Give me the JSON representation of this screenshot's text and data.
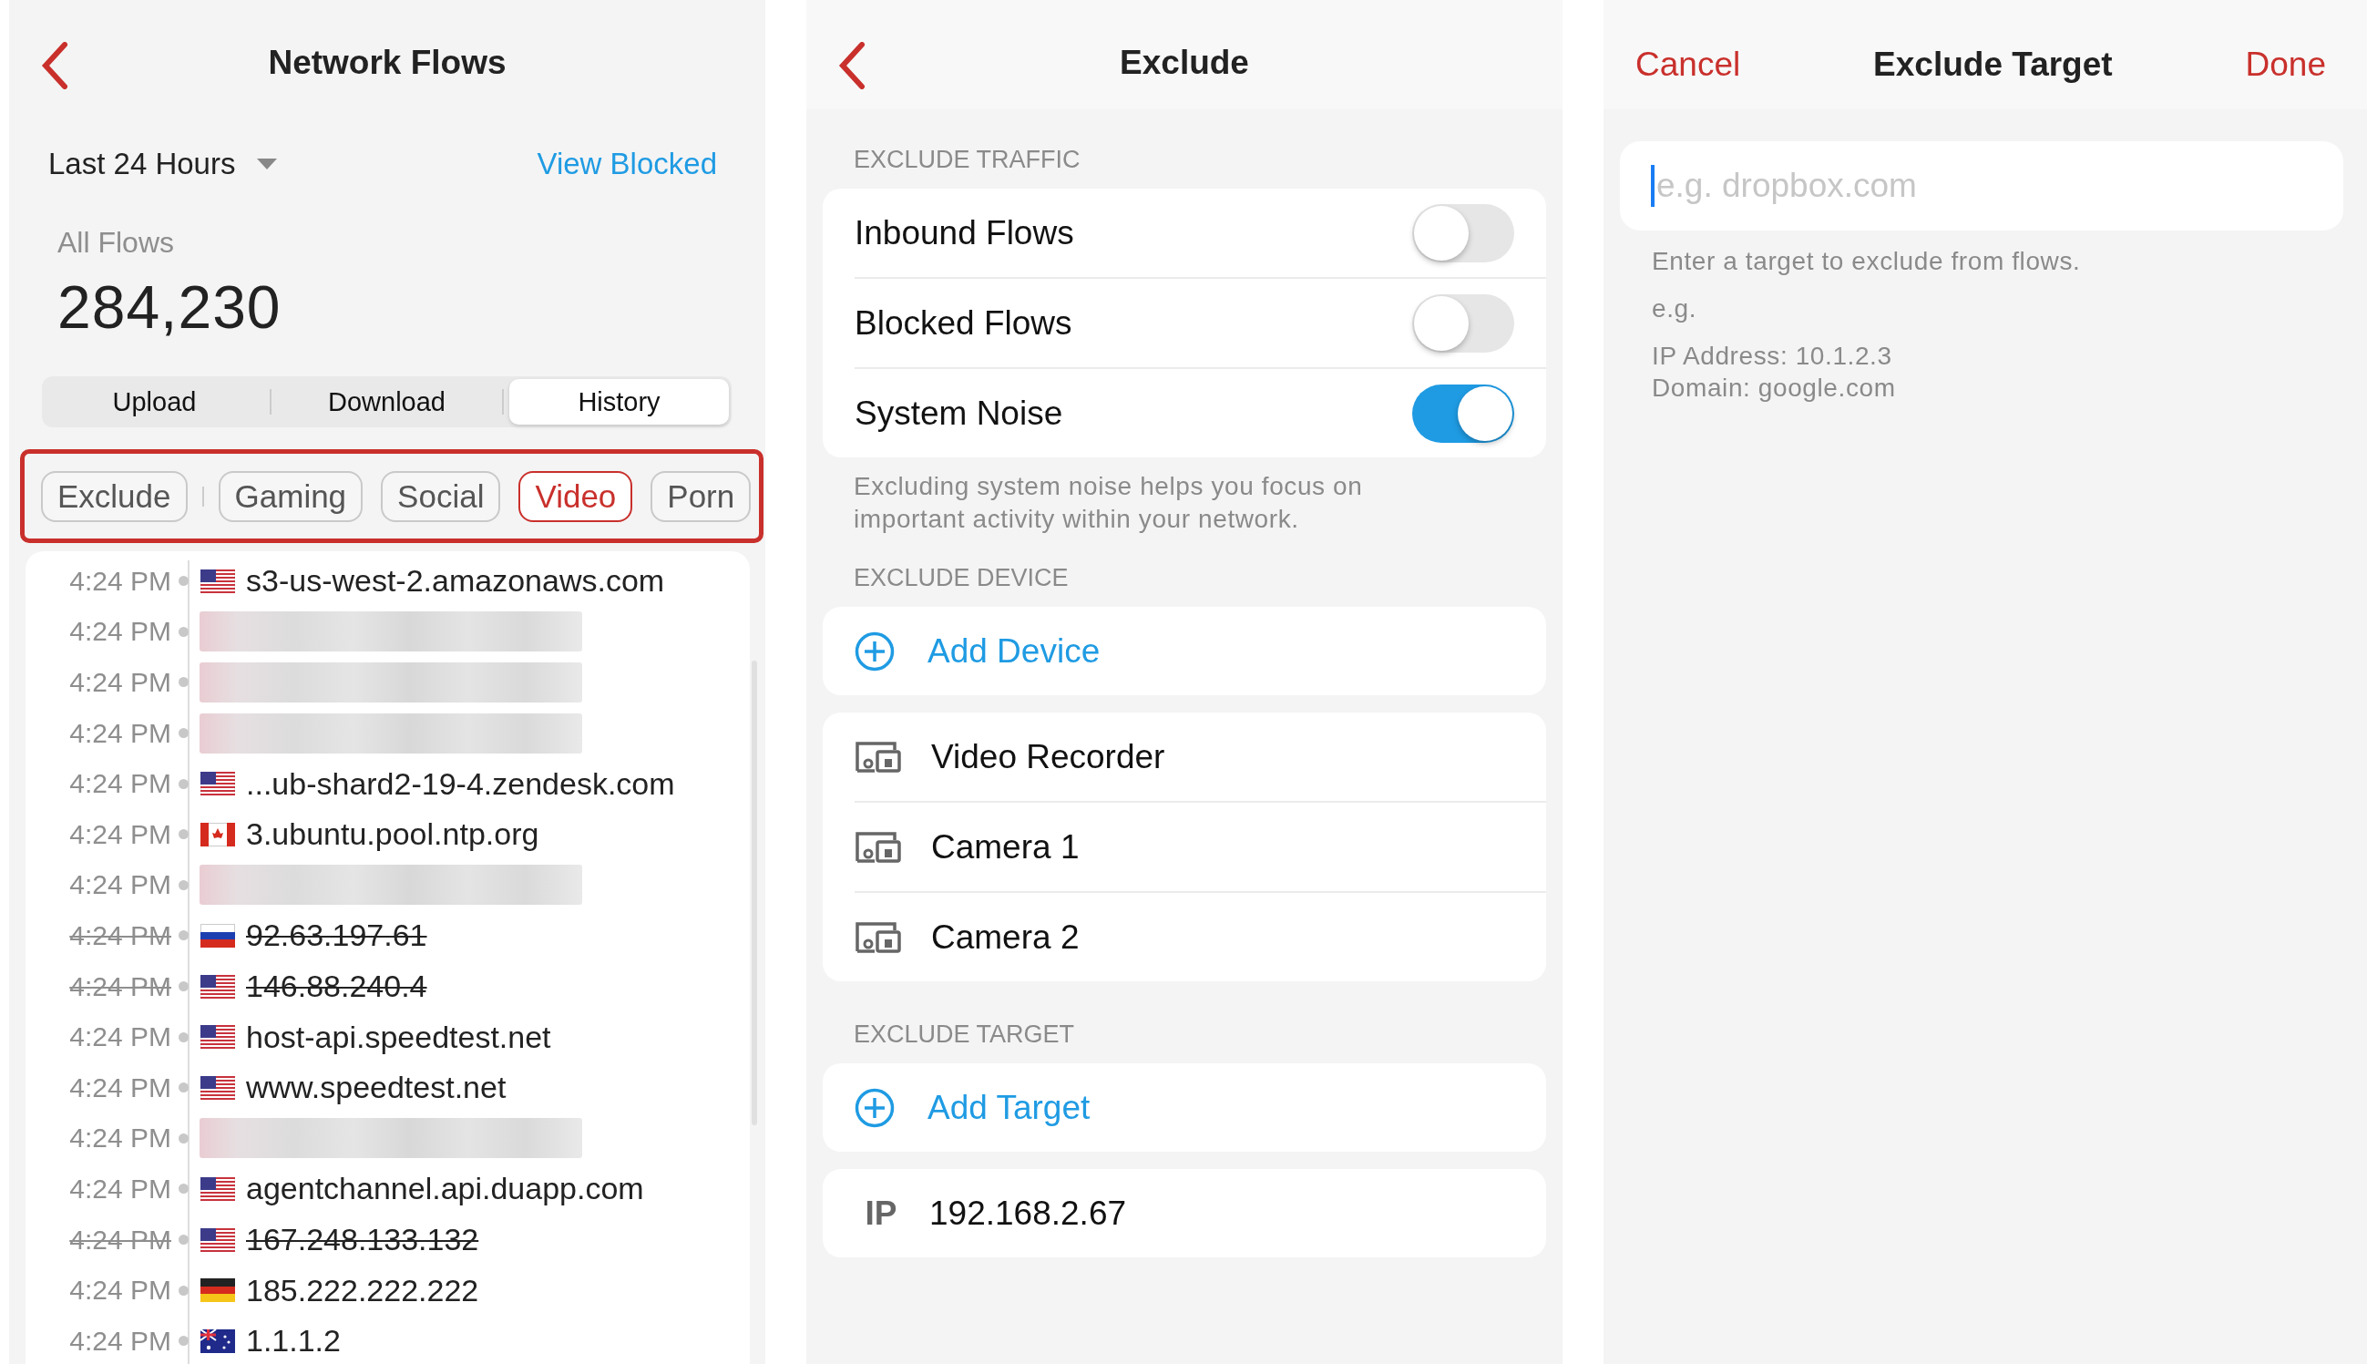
{
  "network_flows": {
    "title": "Network Flows",
    "time_range": "Last 24 Hours",
    "view_blocked": "View Blocked",
    "total_label": "All Flows",
    "total": "284,230",
    "segments": [
      {
        "label": "Upload",
        "selected": false
      },
      {
        "label": "Download",
        "selected": false
      },
      {
        "label": "History",
        "selected": true
      }
    ],
    "filters": [
      {
        "label": "Exclude",
        "selected": false
      },
      {
        "label": "Gaming",
        "selected": false
      },
      {
        "label": "Social",
        "selected": false
      },
      {
        "label": "Video",
        "selected": true
      },
      {
        "label": "Porn",
        "selected": false
      }
    ],
    "flows": [
      {
        "kind": "host",
        "time": "4:24 PM",
        "flag": {
          "kind": "us"
        },
        "host": "s3-us-west-2.amazonaws.com",
        "blocked": false
      },
      {
        "kind": "redacted",
        "time": "4:24 PM"
      },
      {
        "kind": "redacted",
        "time": "4:24 PM"
      },
      {
        "kind": "redacted",
        "time": "4:24 PM"
      },
      {
        "kind": "host",
        "time": "4:24 PM",
        "flag": {
          "kind": "us"
        },
        "host": "...ub-shard2-19-4.zendesk.com",
        "blocked": false
      },
      {
        "kind": "host",
        "time": "4:24 PM",
        "flag": {
          "kind": "ca"
        },
        "host": "3.ubuntu.pool.ntp.org",
        "blocked": false
      },
      {
        "kind": "redacted",
        "time": "4:24 PM"
      },
      {
        "kind": "host",
        "time": "4:24 PM",
        "flag": {
          "kind": "ru"
        },
        "host": "92.63.197.61",
        "blocked": true
      },
      {
        "kind": "host",
        "time": "4:24 PM",
        "flag": {
          "kind": "us"
        },
        "host": "146.88.240.4",
        "blocked": true
      },
      {
        "kind": "host",
        "time": "4:24 PM",
        "flag": {
          "kind": "us"
        },
        "host": "host-api.speedtest.net",
        "blocked": false
      },
      {
        "kind": "host",
        "time": "4:24 PM",
        "flag": {
          "kind": "us"
        },
        "host": "www.speedtest.net",
        "blocked": false
      },
      {
        "kind": "redacted",
        "time": "4:24 PM"
      },
      {
        "kind": "host",
        "time": "4:24 PM",
        "flag": {
          "kind": "us"
        },
        "host": "agentchannel.api.duapp.com",
        "blocked": false
      },
      {
        "kind": "host",
        "time": "4:24 PM",
        "flag": {
          "kind": "us"
        },
        "host": "167.248.133.132",
        "blocked": true
      },
      {
        "kind": "host",
        "time": "4:24 PM",
        "flag": {
          "kind": "de"
        },
        "host": "185.222.222.222",
        "blocked": false
      },
      {
        "kind": "host",
        "time": "4:24 PM",
        "flag": {
          "kind": "au"
        },
        "host": "1.1.1.2",
        "blocked": false
      }
    ]
  },
  "exclude": {
    "title": "Exclude",
    "traffic_header": "EXCLUDE TRAFFIC",
    "traffic": [
      {
        "label": "Inbound Flows",
        "on": false
      },
      {
        "label": "Blocked Flows",
        "on": false
      },
      {
        "label": "System Noise",
        "on": true
      }
    ],
    "traffic_note": "Excluding system noise helps you focus on important activity within your network.",
    "device_header": "EXCLUDE DEVICE",
    "add_device": "Add Device",
    "devices": [
      "Video Recorder",
      "Camera 1",
      "Camera 2"
    ],
    "target_header": "EXCLUDE TARGET",
    "add_target": "Add Target",
    "targets": [
      {
        "type": "IP",
        "value": "192.168.2.67"
      }
    ]
  },
  "exclude_target": {
    "cancel": "Cancel",
    "title": "Exclude Target",
    "done": "Done",
    "placeholder": "e.g. dropbox.com",
    "help": "Enter a target to exclude from flows.",
    "example_label": "e.g.",
    "examples": [
      "IP Address: 10.1.2.3",
      "Domain: google.com"
    ]
  }
}
